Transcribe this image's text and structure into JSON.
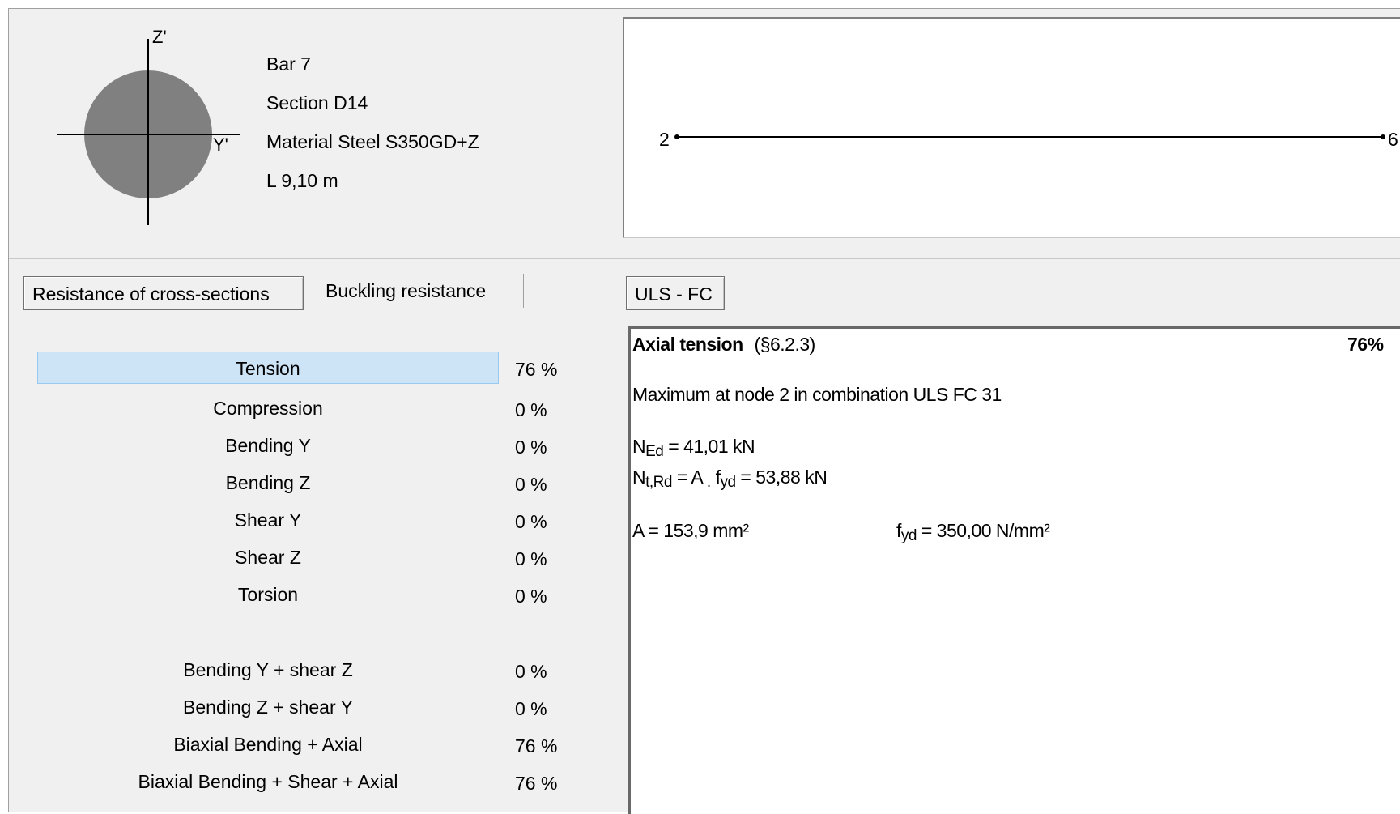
{
  "bar": {
    "name": "Bar 7",
    "section": "Section D14",
    "material": "Material Steel S350GD+Z",
    "length": "L 9,10 m",
    "axis_z": "Z'",
    "axis_y": "Y'"
  },
  "diagram": {
    "start_node": "2",
    "end_node": "6"
  },
  "tabs": {
    "left": [
      "Resistance of cross-sections",
      "Buckling resistance"
    ],
    "right": [
      "ULS - FC"
    ]
  },
  "checks": [
    {
      "label": "Tension",
      "value": "76 %",
      "selected": true
    },
    {
      "label": "Compression",
      "value": "0 %"
    },
    {
      "label": "Bending Y",
      "value": "0 %"
    },
    {
      "label": "Bending Z",
      "value": "0 %"
    },
    {
      "label": "Shear Y",
      "value": "0 %"
    },
    {
      "label": "Shear Z",
      "value": "0 %"
    },
    {
      "label": "Torsion",
      "value": "0 %"
    },
    {
      "label": "Bending Y + shear Z",
      "value": "0 %"
    },
    {
      "label": "Bending Z + shear Y",
      "value": "0 %"
    },
    {
      "label": "Biaxial Bending + Axial",
      "value": "76 %"
    },
    {
      "label": "Biaxial Bending + Shear + Axial",
      "value": "76 %"
    }
  ],
  "result": {
    "title": "Axial tension",
    "clause": "(§6.2.3)",
    "ratio": "76%",
    "location": "Maximum at node 2 in combination ULS FC 31",
    "ned": {
      "symbol": "N",
      "sub": "Ed",
      "value": "= 41,01 kN"
    },
    "ntrd": {
      "symbol": "N",
      "sub": "t,Rd",
      "formula_a": "= A",
      "dot": ".",
      "fyd_sub": "yd",
      "value": "= 53,88 kN"
    },
    "area": "A = 153,9 mm²",
    "fyd": {
      "symbol": "f",
      "sub": "yd",
      "value": "= 350,00 N/mm²"
    }
  }
}
